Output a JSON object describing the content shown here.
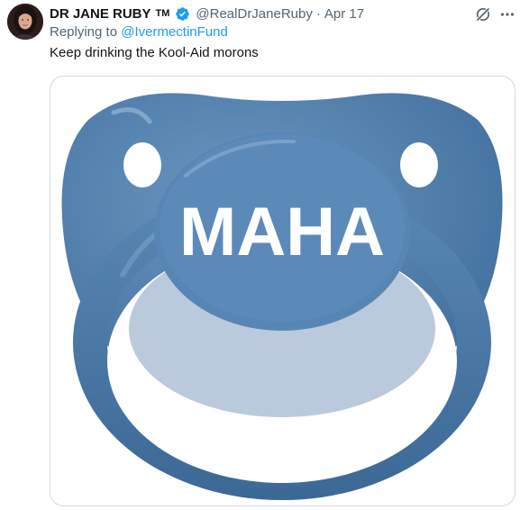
{
  "author": {
    "display_name": "DR JANE RUBY",
    "tm": "TM",
    "handle": "@RealDrJaneRuby",
    "separator": "·",
    "date": "Apr 17",
    "verified_color": "#1d9bf0"
  },
  "reply": {
    "prefix": "Replying to",
    "handle": "@IvermectinFund"
  },
  "tweet": {
    "text": "Keep drinking the Kool-Aid morons"
  },
  "media": {
    "shield_text": "MAHA",
    "pacifier_color": "#4f7fae"
  },
  "icons": {
    "grok": "grok-slash-icon",
    "more": "more-horizontal-icon",
    "verified": "verified-badge-icon"
  }
}
